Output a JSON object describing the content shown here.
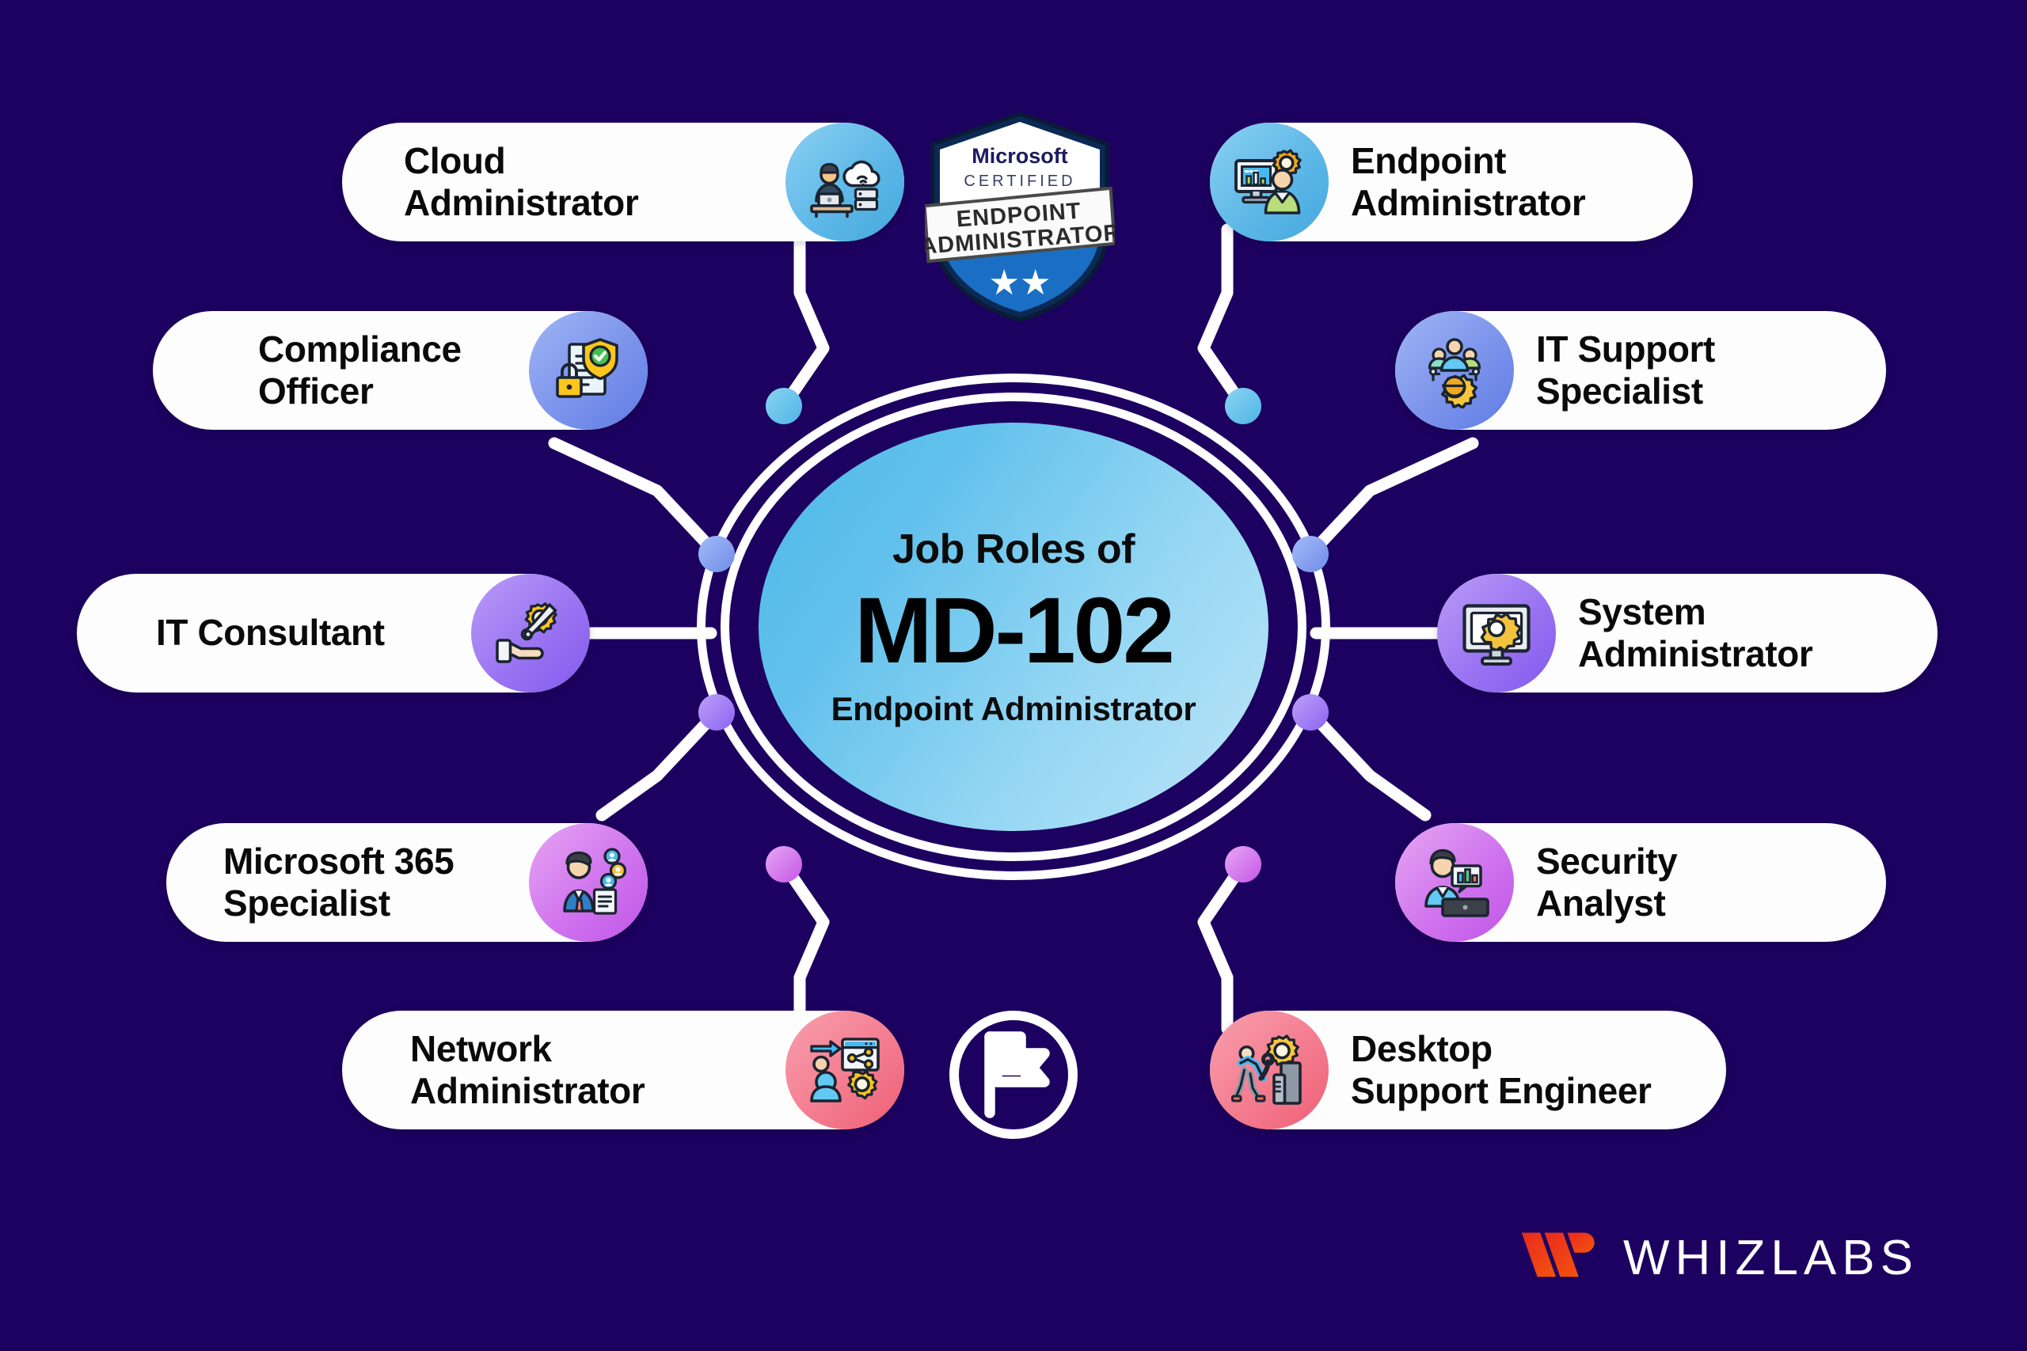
{
  "background_color": "#1d0160",
  "center": {
    "line1": "Job Roles of",
    "line2": "MD-102",
    "line3": "Endpoint Administrator"
  },
  "certification_badge": {
    "brand": "Microsoft",
    "certified": "CERTIFIED",
    "title_line1": "ENDPOINT",
    "title_line2": "ADMINISTRATOR",
    "stars": "★★"
  },
  "brand": {
    "name": "WHIZLABS",
    "logo_color": "#ef3b15"
  },
  "flag_logo": {
    "name": "flag-in-circle-logo"
  },
  "roles_left": [
    {
      "label": "Cloud\nAdministrator",
      "icon": "cloud-admin-icon",
      "bubble": "g-blue2"
    },
    {
      "label": "Compliance\nOfficer",
      "icon": "compliance-doc-lock-icon",
      "bubble": "g-peri"
    },
    {
      "label": "IT Consultant",
      "icon": "hand-gear-wrench-icon",
      "bubble": "g-violet"
    },
    {
      "label": "Microsoft 365\nSpecialist",
      "icon": "m365-specialist-icon",
      "bubble": "g-orchid"
    },
    {
      "label": "Network\nAdministrator",
      "icon": "network-share-gear-icon",
      "bubble": "g-rose"
    }
  ],
  "roles_right": [
    {
      "label": "Endpoint\nAdministrator",
      "icon": "endpoint-monitor-gear-icon",
      "bubble": "g-blue2"
    },
    {
      "label": "IT Support\nSpecialist",
      "icon": "support-team-gear-icon",
      "bubble": "g-peri"
    },
    {
      "label": "System\nAdministrator",
      "icon": "monitor-gear-icon",
      "bubble": "g-violet"
    },
    {
      "label": "Security\nAnalyst",
      "icon": "security-analyst-icon",
      "bubble": "g-orchid"
    },
    {
      "label": "Desktop\nSupport Engineer",
      "icon": "desktop-support-icon",
      "bubble": "g-rose"
    }
  ],
  "ring_nodes": [
    {
      "name": "node-top-left",
      "color": "#62c2ee"
    },
    {
      "name": "node-mid-left",
      "color": "#7d9bec"
    },
    {
      "name": "node-lower-left",
      "color": "#9a7bf3"
    },
    {
      "name": "node-bottom-left",
      "color": "#cf68ea"
    },
    {
      "name": "node-top-right",
      "color": "#62c2ee"
    },
    {
      "name": "node-mid-right",
      "color": "#7d9bec"
    },
    {
      "name": "node-lower-right",
      "color": "#9a7bf3"
    },
    {
      "name": "node-bottom-right",
      "color": "#cf68ea"
    }
  ]
}
